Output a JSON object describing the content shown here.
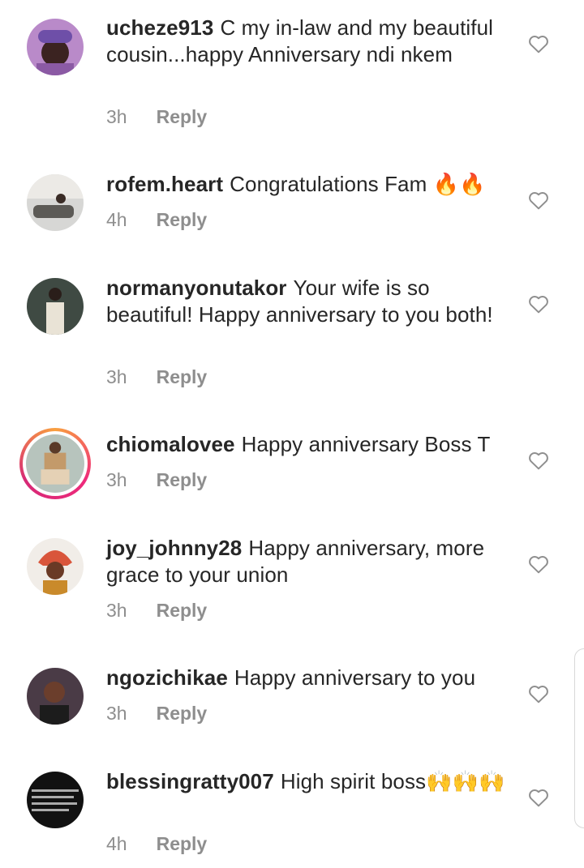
{
  "comments": [
    {
      "username": "ucheze913",
      "text": "C my in-law and my beautiful cousin...happy Anniversary ndi nkem",
      "time": "3h",
      "reply": "Reply"
    },
    {
      "username": "rofem.heart",
      "text": "Congratulations Fam 🔥🔥",
      "time": "4h",
      "reply": "Reply"
    },
    {
      "username": "normanyonutakor",
      "text": "Your wife is so beautiful! Happy anniversary to you both!",
      "time": "3h",
      "reply": "Reply"
    },
    {
      "username": "chiomalovee",
      "text": "Happy anniversary Boss T",
      "time": "3h",
      "reply": "Reply"
    },
    {
      "username": "joy_johnny28",
      "text": "Happy anniversary, more grace to your union",
      "time": "3h",
      "reply": "Reply"
    },
    {
      "username": "ngozichikae",
      "text": "Happy anniversary to you",
      "time": "3h",
      "reply": "Reply"
    },
    {
      "username": "blessingratty007",
      "text": "High spirit boss🙌🙌🙌",
      "time": "4h",
      "reply": "Reply"
    }
  ],
  "icons": {
    "like": "heart-outline-icon"
  },
  "colors": {
    "text": "#262626",
    "meta": "#8e8e8e",
    "heart": "#8e8e8e"
  }
}
